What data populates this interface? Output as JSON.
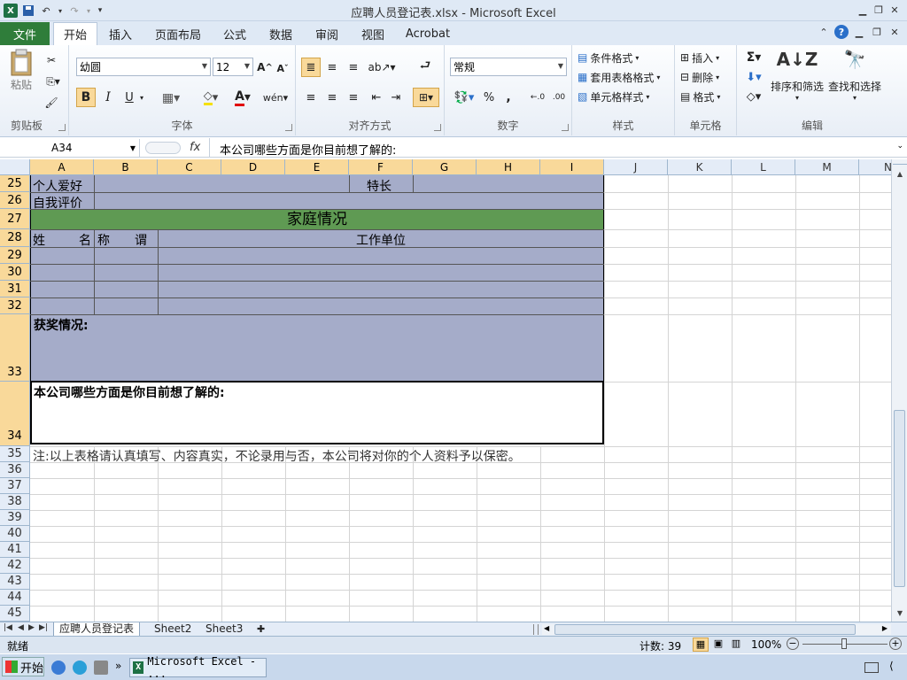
{
  "window": {
    "title": "应聘人员登记表.xlsx - Microsoft Excel"
  },
  "ribbon_tabs": [
    "文件",
    "开始",
    "插入",
    "页面布局",
    "公式",
    "数据",
    "审阅",
    "视图",
    "Acrobat"
  ],
  "ribbon": {
    "clipboard": {
      "label": "剪贴板",
      "paste": "粘贴"
    },
    "font": {
      "label": "字体",
      "name": "幼圆",
      "size": "12",
      "bold": "B",
      "italic": "I",
      "underline": "U"
    },
    "alignment": {
      "label": "对齐方式"
    },
    "number": {
      "label": "数字",
      "format": "常规",
      "percent": "%",
      "comma": ","
    },
    "styles": {
      "label": "样式",
      "items": [
        "条件格式",
        "套用表格格式",
        "单元格样式"
      ]
    },
    "cells": {
      "label": "单元格",
      "items": [
        "插入",
        "删除",
        "格式"
      ]
    },
    "editing": {
      "label": "编辑",
      "sort": "排序和筛选",
      "find": "查找和选择"
    }
  },
  "formula_bar": {
    "name_box": "A34",
    "fx": "fx",
    "content": "本公司哪些方面是你目前想了解的:"
  },
  "columns": [
    "A",
    "B",
    "C",
    "D",
    "E",
    "F",
    "G",
    "H",
    "I",
    "J",
    "K",
    "L",
    "M",
    "N"
  ],
  "rows": [
    "25",
    "26",
    "27",
    "28",
    "29",
    "30",
    "31",
    "32",
    "33",
    "34",
    "35",
    "36",
    "37",
    "38",
    "39",
    "40",
    "41",
    "42",
    "43",
    "44",
    "45"
  ],
  "cells": {
    "r25a": "个人爱好",
    "r25f": "特长",
    "r26a": "自我评价",
    "r27": "家庭情况",
    "r28a": "姓　　名",
    "r28b": "称　　谓",
    "r28c": "工作单位",
    "r33": "获奖情况:",
    "r34": "本公司哪些方面是你目前想了解的:",
    "r35": "注:以上表格请认真填写、内容真实，不论录用与否，本公司将对你的个人资料予以保密。"
  },
  "sheets": [
    "应聘人员登记表",
    "Sheet2",
    "Sheet3"
  ],
  "status": {
    "ready": "就绪",
    "count": "计数: 39",
    "zoom": "100%"
  },
  "taskbar": {
    "start": "开始",
    "app": "Microsoft Excel - ..."
  },
  "colors": {
    "fill": "#a5acc9",
    "band": "#5f9a53",
    "file_tab": "#2f7d3a",
    "selected_header": "#f9d99a"
  }
}
